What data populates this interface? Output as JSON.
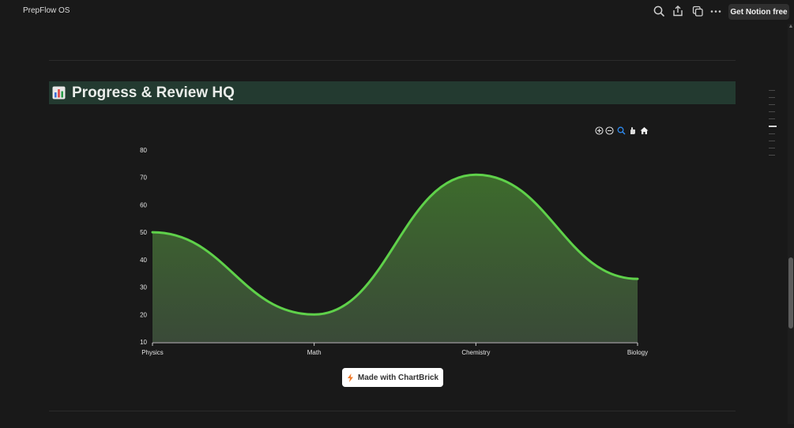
{
  "app": {
    "title": "PrepFlow OS"
  },
  "topbar": {
    "icons": [
      "search-icon",
      "share-icon",
      "duplicate-icon",
      "more-icon"
    ],
    "cta_label": "Get Notion free"
  },
  "heading": {
    "icon": "bar-chart-icon",
    "text": "Progress & Review HQ",
    "background": "#233a30"
  },
  "chart_toolbar": {
    "icons": [
      "zoom-in-icon",
      "zoom-out-icon",
      "zoom-select-icon",
      "pan-icon",
      "reset-home-icon"
    ]
  },
  "chart_data": {
    "type": "area",
    "categories": [
      "Physics",
      "Math",
      "Chemistry",
      "Biology"
    ],
    "series": [
      {
        "values": [
          50,
          20,
          71,
          33
        ],
        "color": "#5fd14a"
      }
    ],
    "xlabel": "",
    "ylabel": "",
    "ylim": [
      10,
      80
    ],
    "yticks": [
      10,
      20,
      30,
      40,
      50,
      60,
      70,
      80
    ],
    "grid": false,
    "legend": "none",
    "smooth": true
  },
  "badge": {
    "label": "Made with ChartBrick",
    "icon": "lightning-icon"
  },
  "colors": {
    "background": "#191919",
    "line": "#5fd14a",
    "fill_top": "#3d6b2c",
    "fill_bottom": "#3a4a38"
  }
}
